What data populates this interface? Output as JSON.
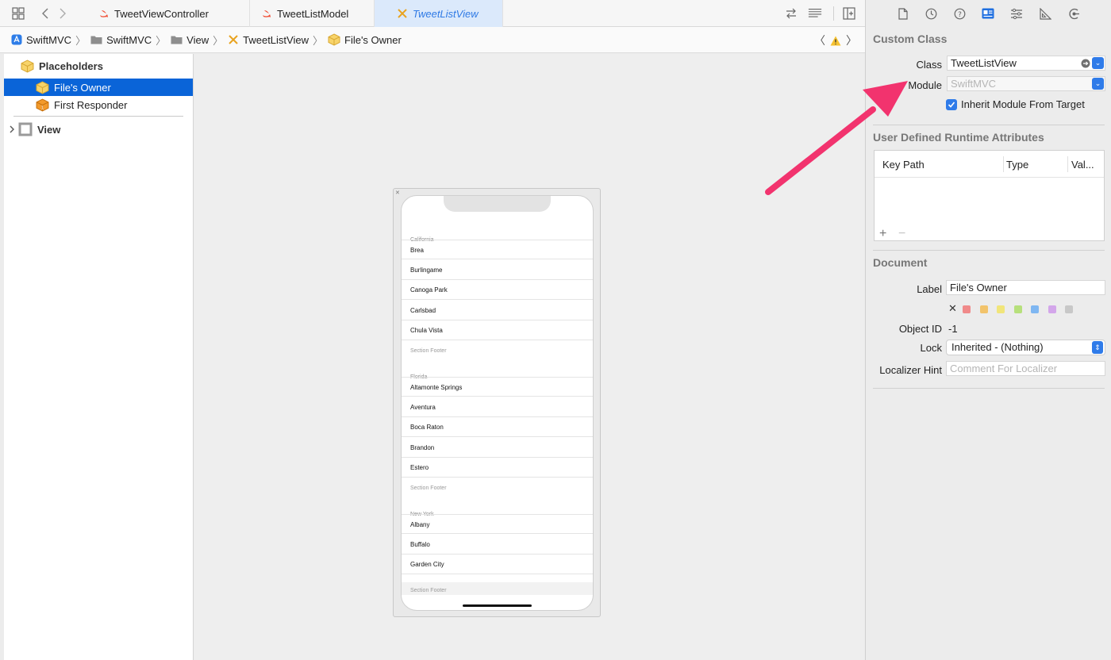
{
  "tabs": [
    {
      "label": "TweetViewController",
      "icon": "swift-icon"
    },
    {
      "label": "TweetListModel",
      "icon": "swift-icon"
    },
    {
      "label": "TweetListView",
      "icon": "interface-builder-icon"
    }
  ],
  "breadcrumb": [
    "SwiftMVC",
    "SwiftMVC",
    "View",
    "TweetListView",
    "File's Owner"
  ],
  "outline": {
    "placeholders_label": "Placeholders",
    "files_owner_label": "File's Owner",
    "first_responder_label": "First Responder",
    "view_label": "View"
  },
  "device": {
    "sections": [
      {
        "header": "California",
        "rows": [
          "Brea",
          "Burlingame",
          "Canoga Park",
          "Carlsbad",
          "Chula Vista"
        ],
        "footer": "Section Footer"
      },
      {
        "header": "Florida",
        "rows": [
          "Altamonte Springs",
          "Aventura",
          "Boca Raton",
          "Brandon",
          "Estero"
        ],
        "footer": "Section Footer"
      },
      {
        "header": "New York",
        "rows": [
          "Albany",
          "Buffalo",
          "Garden City"
        ],
        "footer": "Section Footer"
      }
    ]
  },
  "inspector": {
    "custom_class": {
      "title": "Custom Class",
      "class_label": "Class",
      "class_value": "TweetListView",
      "module_label": "Module",
      "module_placeholder": "SwiftMVC",
      "inherit_label": "Inherit Module From Target",
      "inherit_checked": true
    },
    "runtime_attrs": {
      "title": "User Defined Runtime Attributes",
      "columns": [
        "Key Path",
        "Type",
        "Val..."
      ],
      "add_label": "+",
      "remove_label": "−"
    },
    "document": {
      "title": "Document",
      "label_label": "Label",
      "label_value": "File's Owner",
      "object_id_label": "Object ID",
      "object_id_value": "-1",
      "lock_label": "Lock",
      "lock_value": "Inherited - (Nothing)",
      "localizer_label": "Localizer Hint",
      "localizer_placeholder": "Comment For Localizer",
      "color_clear": "✕",
      "label_colors": [
        "#f08a8a",
        "#f2c36b",
        "#f1e57a",
        "#b7e07c",
        "#7fb7f2",
        "#d3a6ea",
        "#c8c8c8"
      ]
    }
  },
  "colors": {
    "accent": "#1f6fe0",
    "arrow": "#f2336e",
    "selection": "#0a64d8"
  }
}
